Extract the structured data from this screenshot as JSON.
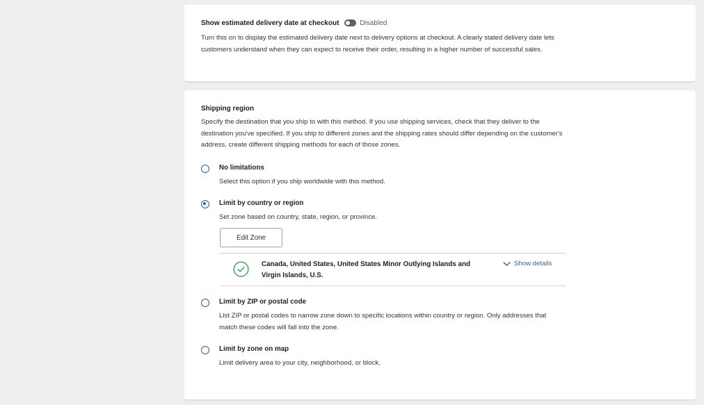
{
  "delivery_date": {
    "title": "Show estimated delivery date at checkout",
    "toggle_state": "Disabled",
    "description": "Turn this on to display the estimated delivery date next to delivery options at checkout. A clearly stated delivery date lets customers understand when they can expect to receive their order, resulting in a higher number of successful sales."
  },
  "shipping_region": {
    "title": "Shipping region",
    "description": "Specify the destination that you ship to with this method. If you use shipping services, check that they deliver to the destination you've specified. If you ship to different zones and the shipping rates should differ depending on the customer's address, create different shipping methods for each of those zones.",
    "options": [
      {
        "label": "No limitations",
        "description": "Select this option if you ship worldwide with this method.",
        "checked": false
      },
      {
        "label": "Limit by country or region",
        "description": "Set zone based on country, state, region, or province.",
        "checked": true
      },
      {
        "label": "Limit by ZIP or postal code",
        "description": "List ZIP or postal codes to narrow zone down to specific locations within country or region. Only addresses that match these codes will fall into the zone.",
        "checked": false
      },
      {
        "label": "Limit by zone on map",
        "description": "Limit delivery area to your city, neighborhood, or block.",
        "checked": false
      }
    ],
    "edit_zone_label": "Edit Zone",
    "zone_summary": "Canada, United States, United States Minor Outlying Islands and Virgin Islands, U.S.",
    "show_details_label": "Show details"
  },
  "colors": {
    "accent": "#2b5fb8",
    "success": "#2e9e55",
    "background": "#eceef0",
    "card": "#ffffff"
  },
  "icons": {
    "check": "check-circle-icon",
    "chevron": "chevron-down-icon"
  }
}
